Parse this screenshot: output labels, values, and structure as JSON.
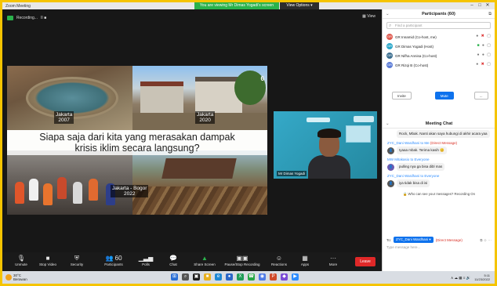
{
  "titlebar": {
    "title": "Zoom Meeting"
  },
  "share_banner": "You are viewing Mr Dimas Yogadi's screen",
  "view_options": "View Options ▾",
  "window_controls": {
    "minimize": "–",
    "maximize": "□",
    "close": "✕"
  },
  "video_top": {
    "recording": "Recording...",
    "icons": "II  ■",
    "view": "▦ View"
  },
  "slide": {
    "headline_line1": "Siapa saja dari kita yang merasakan dampak",
    "headline_line2": "krisis iklim secara langsung?",
    "slide_number": "6",
    "captions": [
      {
        "place": "Jakarta",
        "year": "2007"
      },
      {
        "place": "Jakarta",
        "year": "2020"
      },
      {
        "place": "Jakarta - Bogor",
        "year": "2022"
      }
    ]
  },
  "participant_tile": {
    "name": "Mr Dimas Yogadi"
  },
  "toolbar": {
    "items": [
      {
        "icon": "🎙",
        "icon_name": "microphone-icon",
        "label": "Unmute"
      },
      {
        "icon": "■",
        "icon_name": "video-camera-icon",
        "label": "Stop Video"
      },
      {
        "icon": "⛨",
        "icon_name": "shield-icon",
        "label": "Security"
      },
      {
        "icon": "👥 60",
        "icon_name": "participants-icon",
        "label": "Participants"
      },
      {
        "icon": "▁▃▅",
        "icon_name": "poll-icon",
        "label": "Polls"
      },
      {
        "icon": "💬",
        "icon_name": "chat-icon",
        "label": "Chat"
      },
      {
        "icon": "▲",
        "icon_name": "share-screen-icon",
        "label": "Share Screen"
      },
      {
        "icon": "▣▣",
        "icon_name": "record-icon",
        "label": "Pause/Stop Recording"
      },
      {
        "icon": "☺",
        "icon_name": "reactions-icon",
        "label": "Reactions"
      },
      {
        "icon": "▦",
        "icon_name": "apps-icon",
        "label": "Apps"
      },
      {
        "icon": "···",
        "icon_name": "more-icon",
        "label": "More"
      }
    ],
    "end_label": "Leave"
  },
  "participants_panel": {
    "header": "Participants (60)",
    "search_placeholder": "Find a participant",
    "participants": [
      {
        "initials": "GR",
        "color": "#e05a4f",
        "name": "GR Innamid (Co-host, me)"
      },
      {
        "initials": "GR",
        "color": "#2aa7c9",
        "name": "GR Dimas Yogadi (Host)"
      },
      {
        "initials": "GR",
        "color": "#3b6e8f",
        "name": "GR Nifha Annisa (Co-host)"
      },
      {
        "initials": "GR",
        "color": "#5a7bd6",
        "name": "GR Rizqi B (Co-host)"
      }
    ],
    "buttons": {
      "invite": "Invite",
      "mute_all": "Mute All",
      "more": "..."
    }
  },
  "chat_panel": {
    "header": "Meeting Chat",
    "messages": [
      {
        "from": "",
        "dm": "",
        "text": "Rock, Mbak. Nanti akan saya hubungi di akhir acara yaa",
        "initials": "",
        "color": ""
      },
      {
        "from": "ZYC_Dani Wardhani to Me",
        "dm": "(Direct Message)",
        "text": "Iyaaa mbak. Terima kasih 😊",
        "initials": "👤",
        "color": "#555"
      },
      {
        "from": "MW Mitakasio to Everyone",
        "dm": "",
        "text": "pulling nya ga bisa dibl mas",
        "initials": "👤",
        "color": "#6b5bb0"
      },
      {
        "from": "ZYC_Dani Wardhani to Everyone",
        "dm": "",
        "text": "iya tidak bisa di isi",
        "initials": "👤",
        "color": "#555"
      }
    ],
    "who_can_see": "🔒 Who can see your messages? Recording On",
    "to_label": "To:",
    "to_selected": "ZYC_Dani Wardhani ▾",
    "to_dm": "(Direct Message)",
    "type_placeholder": "Type message here..."
  },
  "taskbar": {
    "temperature": "30°C",
    "weather": "Berawan",
    "tray": "∧  ☁  ▦  ≡  🔊",
    "time": "5:11",
    "date": "11/23/2022"
  }
}
